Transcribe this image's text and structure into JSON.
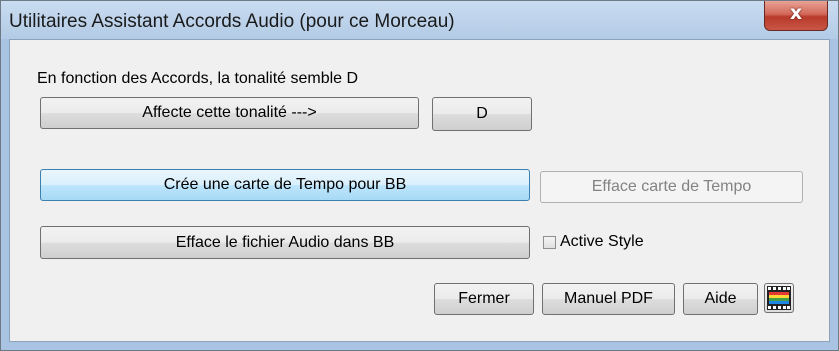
{
  "window": {
    "title": "Utilitaires Assistant Accords Audio (pour ce Morceau)",
    "close_glyph": "x"
  },
  "key_section": {
    "info_text": "En fonction des Accords, la tonalité semble D",
    "assign_key_label": "Affecte cette tonalité --->",
    "key_value": "D"
  },
  "tempo_section": {
    "create_tempo_map_label": "Crée une carte de Tempo pour BB",
    "clear_tempo_map_label": "Efface carte de Tempo"
  },
  "audio_section": {
    "clear_audio_label": "Efface le fichier Audio dans BB",
    "active_style_label": "Active Style",
    "active_style_checked": false
  },
  "footer": {
    "close_label": "Fermer",
    "pdf_manual_label": "Manuel PDF",
    "help_label": "Aide",
    "video_icon": "film-clapper-icon"
  },
  "colors": {
    "titlebar": "#b9cfe8",
    "close_button": "#c75040",
    "dialog_bg": "#f0f0f0",
    "focus_border": "#3c7fb1"
  }
}
